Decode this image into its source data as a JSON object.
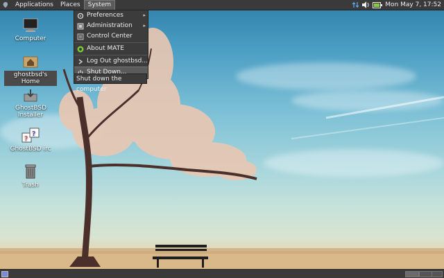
{
  "top_panel": {
    "menus": [
      "Applications",
      "Places",
      "System"
    ],
    "clock": "Mon May  7, 17:52"
  },
  "system_menu": {
    "items": [
      {
        "label": "Preferences",
        "icon": "preferences-icon",
        "submenu": true
      },
      {
        "label": "Administration",
        "icon": "administration-icon",
        "submenu": true
      },
      {
        "label": "Control Center",
        "icon": "control-center-icon",
        "submenu": false
      },
      {
        "label": "About MATE",
        "icon": "mate-logo-icon",
        "submenu": false
      },
      {
        "label": "Log Out ghostbsd...",
        "icon": "logout-icon",
        "submenu": false
      },
      {
        "label": "Shut Down...",
        "icon": "power-icon",
        "submenu": false
      }
    ],
    "tooltip": "Shut down the computer"
  },
  "desktop_icons": [
    {
      "label": "Computer",
      "icon": "computer-icon"
    },
    {
      "label": "ghostbsd's Home",
      "icon": "home-folder-icon"
    },
    {
      "label": "GhostBSD Installer",
      "icon": "installer-icon"
    },
    {
      "label": "GhostBSD irc",
      "icon": "help-chat-icon"
    },
    {
      "label": "Trash",
      "icon": "trash-icon"
    }
  ],
  "colors": {
    "panel": "#3a3a3a",
    "menu": "#3c3c3c",
    "highlight": "#5b5b5b"
  }
}
